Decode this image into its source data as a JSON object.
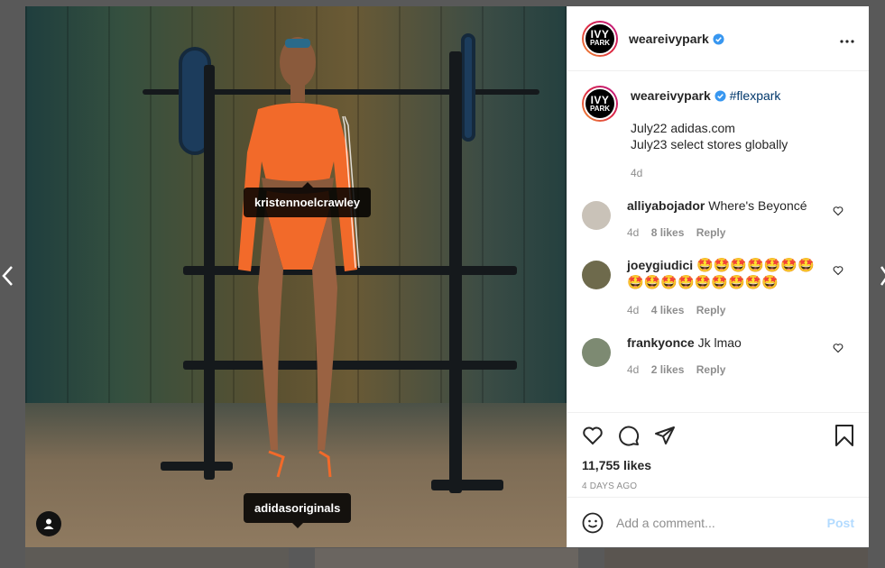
{
  "post": {
    "username": "weareivypark",
    "avatar_text_line1": "IVY",
    "avatar_text_line2": "PARK",
    "caption_hashtag": "#flexpark",
    "caption_text": "July22 adidas.com\nJuly23 select stores globally",
    "caption_age": "4d",
    "likes": "11,755 likes",
    "date": "4 DAYS AGO"
  },
  "photo": {
    "tag_top": "kristennoelcrawley",
    "tag_bottom": "adidasoriginals"
  },
  "comments": [
    {
      "user": "alliyabojador",
      "text": "Where's Beyoncé",
      "age": "4d",
      "likes": "8 likes",
      "reply": "Reply"
    },
    {
      "user": "joeygiudici",
      "text": "🤩🤩🤩🤩🤩🤩🤩🤩🤩🤩🤩🤩🤩🤩🤩🤩",
      "age": "4d",
      "likes": "4 likes",
      "reply": "Reply"
    },
    {
      "user": "frankyonce",
      "text": "Jk lmao",
      "age": "4d",
      "likes": "2 likes",
      "reply": "Reply"
    }
  ],
  "add_comment": {
    "placeholder": "Add a comment...",
    "post_label": "Post"
  },
  "colors": {
    "verified": "#3897f0",
    "hashtag": "#00376b",
    "post_disabled": "#b3dbff"
  },
  "icons": [
    "chevron-left-icon",
    "chevron-right-icon",
    "verified-icon",
    "more-icon",
    "heart-icon",
    "comment-icon",
    "share-icon",
    "bookmark-icon",
    "emoji-icon",
    "user-tag-icon"
  ]
}
